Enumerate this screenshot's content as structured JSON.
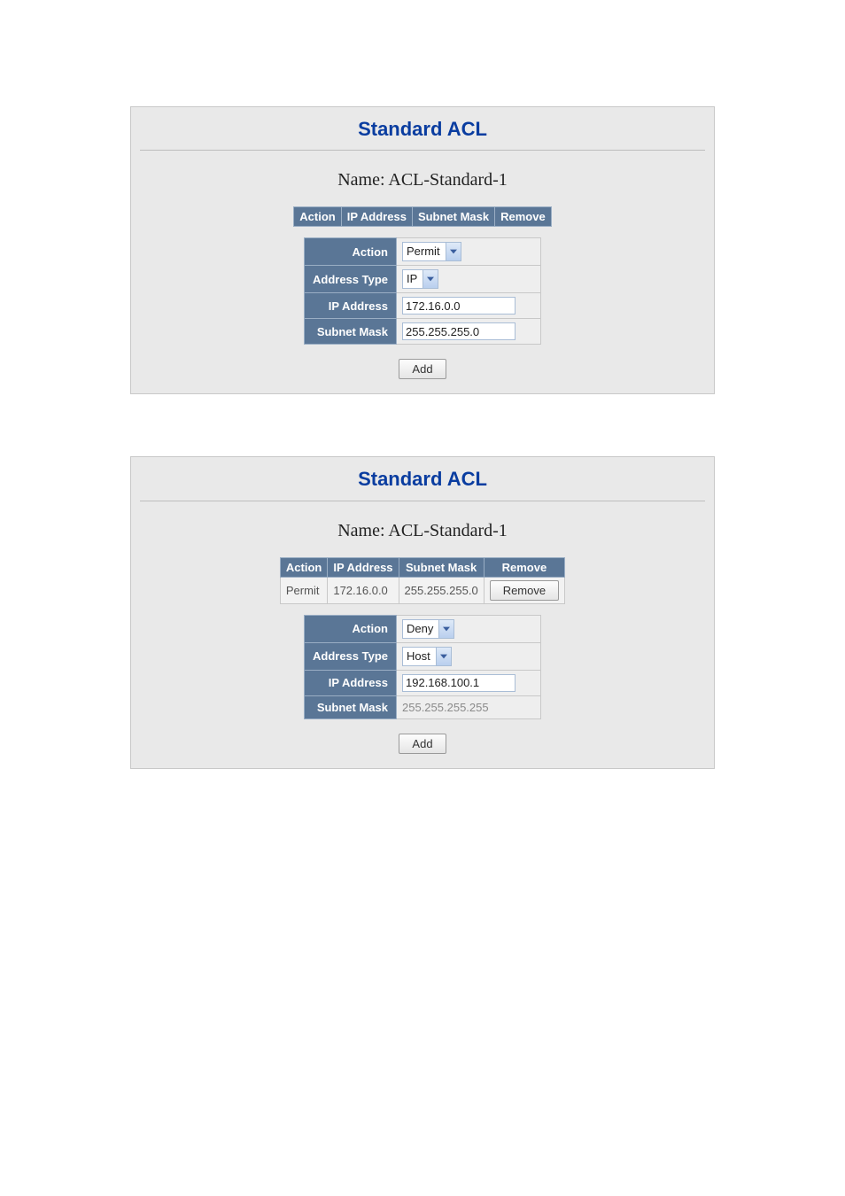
{
  "panels": [
    {
      "title": "Standard ACL",
      "name_line": "Name: ACL-Standard-1",
      "headers": [
        "Action",
        "IP Address",
        "Subnet Mask",
        "Remove"
      ],
      "rows": [],
      "form": {
        "labels": {
          "action": "Action",
          "addr_type": "Address Type",
          "ip": "IP Address",
          "mask": "Subnet Mask"
        },
        "action_value": "Permit",
        "addr_type_value": "IP",
        "ip_value": "172.16.0.0",
        "mask_editable": true,
        "mask_value": "255.255.255.0",
        "add_label": "Add"
      }
    },
    {
      "title": "Standard ACL",
      "name_line": "Name: ACL-Standard-1",
      "headers": [
        "Action",
        "IP Address",
        "Subnet Mask",
        "Remove"
      ],
      "rows": [
        {
          "action": "Permit",
          "ip": "172.16.0.0",
          "mask": "255.255.255.0",
          "remove_label": "Remove"
        }
      ],
      "form": {
        "labels": {
          "action": "Action",
          "addr_type": "Address Type",
          "ip": "IP Address",
          "mask": "Subnet Mask"
        },
        "action_value": "Deny",
        "addr_type_value": "Host",
        "ip_value": "192.168.100.1",
        "mask_editable": false,
        "mask_value": "255.255.255.255",
        "add_label": "Add"
      }
    }
  ]
}
